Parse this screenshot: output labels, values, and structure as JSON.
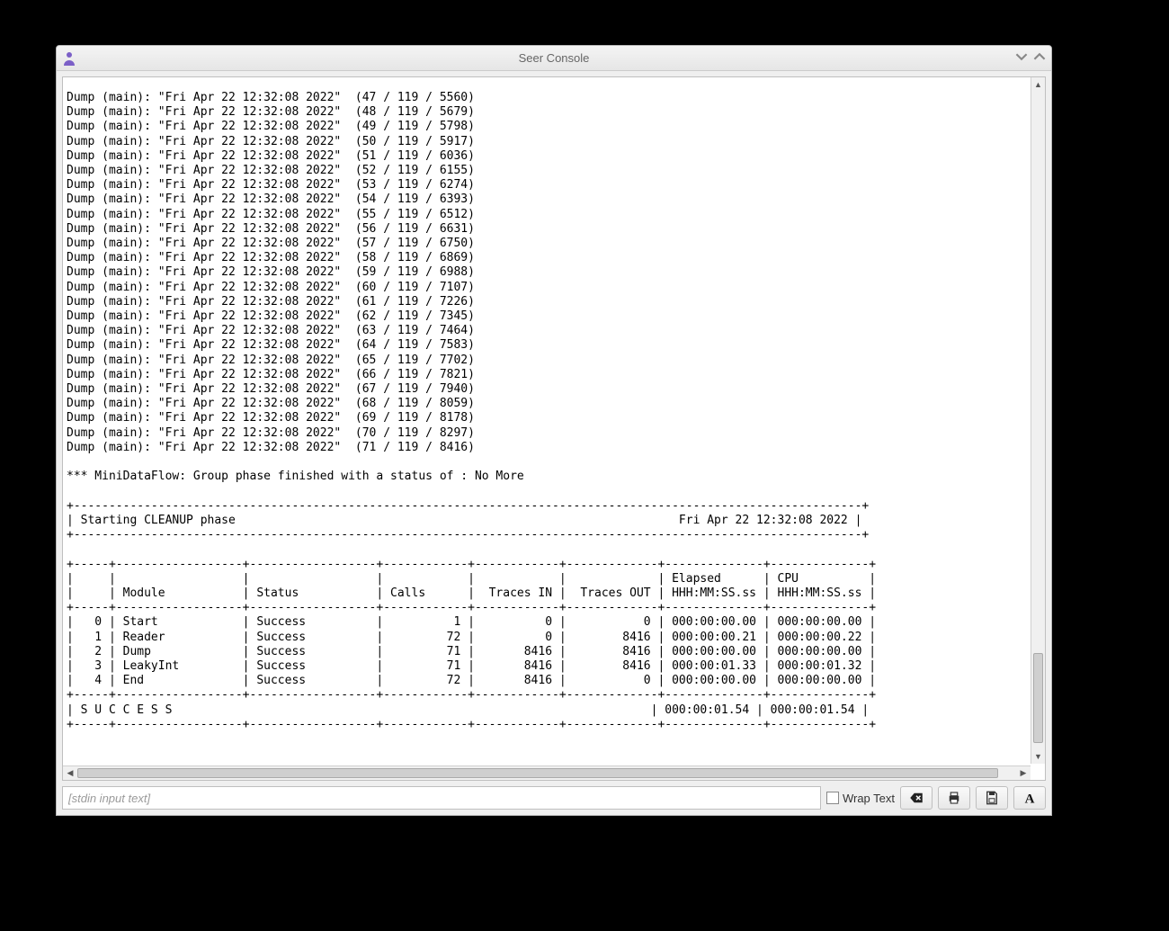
{
  "window": {
    "title": "Seer Console"
  },
  "console": {
    "dump_prefix": "Dump (main): \"Fri Apr 22 12:32:08 2022\"",
    "dump_lines": [
      "(47 / 119 / 5560)",
      "(48 / 119 / 5679)",
      "(49 / 119 / 5798)",
      "(50 / 119 / 5917)",
      "(51 / 119 / 6036)",
      "(52 / 119 / 6155)",
      "(53 / 119 / 6274)",
      "(54 / 119 / 6393)",
      "(55 / 119 / 6512)",
      "(56 / 119 / 6631)",
      "(57 / 119 / 6750)",
      "(58 / 119 / 6869)",
      "(59 / 119 / 6988)",
      "(60 / 119 / 7107)",
      "(61 / 119 / 7226)",
      "(62 / 119 / 7345)",
      "(63 / 119 / 7464)",
      "(64 / 119 / 7583)",
      "(65 / 119 / 7702)",
      "(66 / 119 / 7821)",
      "(67 / 119 / 7940)",
      "(68 / 119 / 8059)",
      "(69 / 119 / 8178)",
      "(70 / 119 / 8297)",
      "(71 / 119 / 8416)"
    ],
    "status_line": "*** MiniDataFlow: Group phase finished with a status of : No More",
    "phase_header": {
      "label": "Starting CLEANUP phase",
      "timestamp": "Fri Apr 22 12:32:08 2022"
    },
    "table": {
      "headers": {
        "idx": "",
        "module": "Module",
        "status": "Status",
        "calls": "Calls",
        "traces_in": "Traces IN",
        "traces_out": "Traces OUT",
        "elapsed_h1": "Elapsed",
        "elapsed_h2": "HHH:MM:SS.ss",
        "cpu_h1": "CPU",
        "cpu_h2": "HHH:MM:SS.ss"
      },
      "rows": [
        {
          "idx": "0",
          "module": "Start",
          "status": "Success",
          "calls": "1",
          "tin": "0",
          "tout": "0",
          "elapsed": "000:00:00.00",
          "cpu": "000:00:00.00"
        },
        {
          "idx": "1",
          "module": "Reader",
          "status": "Success",
          "calls": "72",
          "tin": "0",
          "tout": "8416",
          "elapsed": "000:00:00.21",
          "cpu": "000:00:00.22"
        },
        {
          "idx": "2",
          "module": "Dump",
          "status": "Success",
          "calls": "71",
          "tin": "8416",
          "tout": "8416",
          "elapsed": "000:00:00.00",
          "cpu": "000:00:00.00"
        },
        {
          "idx": "3",
          "module": "LeakyInt",
          "status": "Success",
          "calls": "71",
          "tin": "8416",
          "tout": "8416",
          "elapsed": "000:00:01.33",
          "cpu": "000:00:01.32"
        },
        {
          "idx": "4",
          "module": "End",
          "status": "Success",
          "calls": "72",
          "tin": "8416",
          "tout": "0",
          "elapsed": "000:00:00.00",
          "cpu": "000:00:00.00"
        }
      ],
      "footer": {
        "label": "S U C C E S S",
        "elapsed": "000:00:01.54",
        "cpu": "000:00:01.54"
      }
    }
  },
  "bottom": {
    "placeholder": "[stdin input text]",
    "wrap_label": "Wrap Text"
  },
  "icons": {
    "app": "seer-icon",
    "clear": "backspace-icon",
    "print": "print-icon",
    "save": "save-icon",
    "font": "font-icon"
  }
}
